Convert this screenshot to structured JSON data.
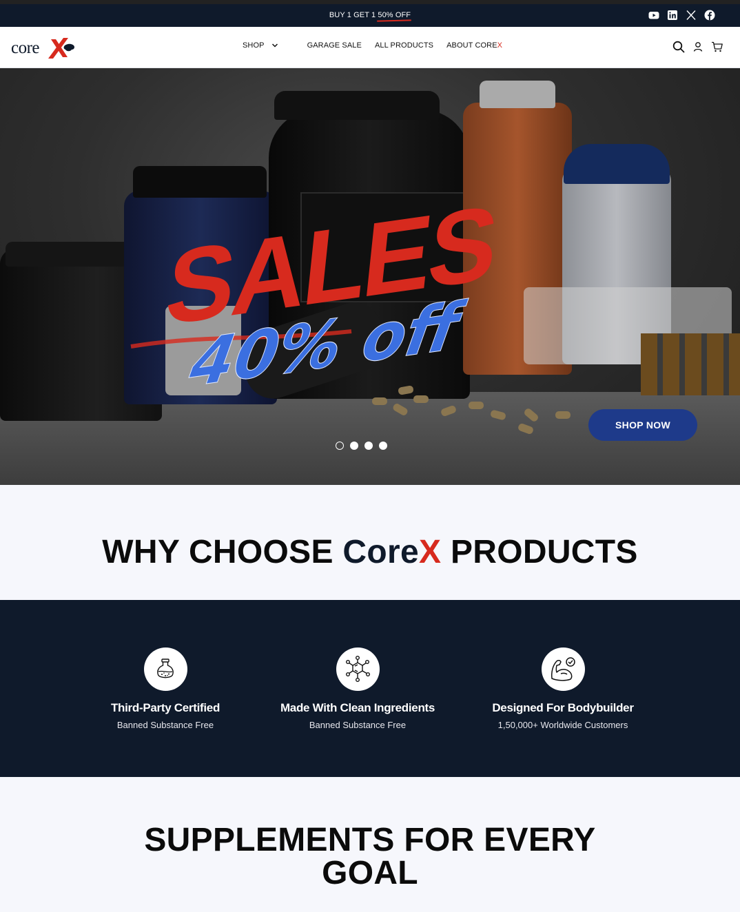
{
  "promo": {
    "text_before": "BUY 1 GET 1 ",
    "text_highlight": "50% OFF",
    "socials": [
      "youtube-icon",
      "linkedin-icon",
      "x-icon",
      "facebook-icon"
    ]
  },
  "header": {
    "logo_text": "core",
    "nav": {
      "shop": "SHOP",
      "garage_sale": "GARAGE SALE",
      "all_products": "ALL PRODUCTS",
      "about_prefix": "ABOUT CORE",
      "about_x": "X"
    },
    "icons": [
      "search-icon",
      "user-icon",
      "cart-icon"
    ]
  },
  "hero": {
    "headline": "SALES",
    "subline": "40% off",
    "cta": "SHOP NOW",
    "slides": 4,
    "active_slide": 1,
    "colors": {
      "headline": "#d72a1e",
      "subline": "#3b6fe0",
      "cta": "#1e3a8a"
    }
  },
  "why": {
    "title_before": "WHY CHOOSE ",
    "title_core": "Core",
    "title_x": "X",
    "title_after": " PRODUCTS"
  },
  "features": [
    {
      "icon": "flask-icon",
      "title": "Third-Party Certified",
      "subtitle": "Banned Substance Free"
    },
    {
      "icon": "molecule-icon",
      "title": "Made With Clean Ingredients",
      "subtitle": "Banned Substance Free"
    },
    {
      "icon": "bicep-icon",
      "title": "Designed For Bodybuilder",
      "subtitle": "1,50,000+ Worldwide Customers"
    }
  ],
  "supplements": {
    "title": "SUPPLEMENTS FOR EVERY GOAL"
  },
  "colors": {
    "navy": "#0f1a2b",
    "brand_red": "#d72a1e",
    "background": "#f6f7fc"
  }
}
